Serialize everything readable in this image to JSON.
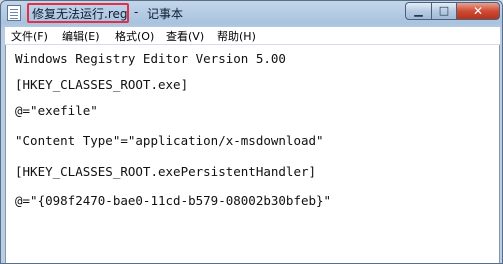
{
  "window": {
    "file_name": "修复无法运行.reg",
    "separator": "-",
    "app_name": "记事本",
    "controls": {
      "minimize_glyph": "▁",
      "maximize_glyph": "□",
      "close_glyph": "✕"
    },
    "colors": {
      "highlight_border": "#e0304a",
      "close_button": "#cf4b33"
    }
  },
  "menu": {
    "items": [
      {
        "label": "文件(F)"
      },
      {
        "label": "编辑(E)"
      },
      {
        "label": "格式(O)"
      },
      {
        "label": "查看(V)"
      },
      {
        "label": "帮助(H)"
      }
    ]
  },
  "editor": {
    "lines": [
      "Windows Registry Editor Version 5.00",
      "[HKEY_CLASSES_ROOT.exe]",
      "@=\"exefile\"",
      "\"Content Type\"=\"application/x-msdownload\"",
      "[HKEY_CLASSES_ROOT.exePersistentHandler]",
      "@=\"{098f2470-bae0-11cd-b579-08002b30bfeb}\""
    ]
  }
}
